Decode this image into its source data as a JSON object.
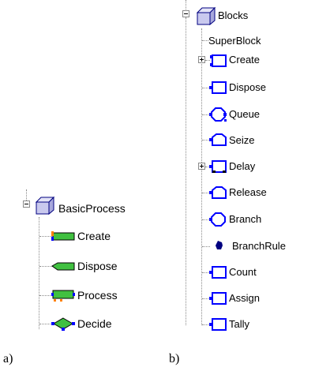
{
  "panel_a": {
    "caption": "a)",
    "root": {
      "label": "BasicProcess",
      "icon": "cube-icon",
      "expander": "minus"
    },
    "items": [
      {
        "label": "Create",
        "icon": "create-module-icon"
      },
      {
        "label": "Dispose",
        "icon": "dispose-module-icon"
      },
      {
        "label": "Process",
        "icon": "process-module-icon"
      },
      {
        "label": "Decide",
        "icon": "decide-module-icon"
      }
    ]
  },
  "panel_b": {
    "caption": "b)",
    "root": {
      "label": "Blocks",
      "icon": "cube-icon",
      "expander": "minus"
    },
    "items": [
      {
        "label": "SuperBlock",
        "icon": "none"
      },
      {
        "label": "Create",
        "icon": "create-block-icon",
        "expander": "plus"
      },
      {
        "label": "Dispose",
        "icon": "dispose-block-icon"
      },
      {
        "label": "Queue",
        "icon": "queue-block-icon"
      },
      {
        "label": "Seize",
        "icon": "seize-block-icon"
      },
      {
        "label": "Delay",
        "icon": "delay-block-icon",
        "expander": "plus"
      },
      {
        "label": "Release",
        "icon": "release-block-icon"
      },
      {
        "label": "Branch",
        "icon": "branch-block-icon"
      },
      {
        "label": "BranchRule",
        "icon": "branchrule-icon"
      },
      {
        "label": "Count",
        "icon": "count-block-icon"
      },
      {
        "label": "Assign",
        "icon": "assign-block-icon"
      },
      {
        "label": "Tally",
        "icon": "tally-block-icon"
      }
    ]
  },
  "colors": {
    "tree_line": "#8a8a8a",
    "cube_edge": "#000080",
    "cube_face": "#c9c9ee",
    "block_blue": "#0000ff",
    "module_green": "#40c040",
    "module_orange": "#ff8000"
  }
}
